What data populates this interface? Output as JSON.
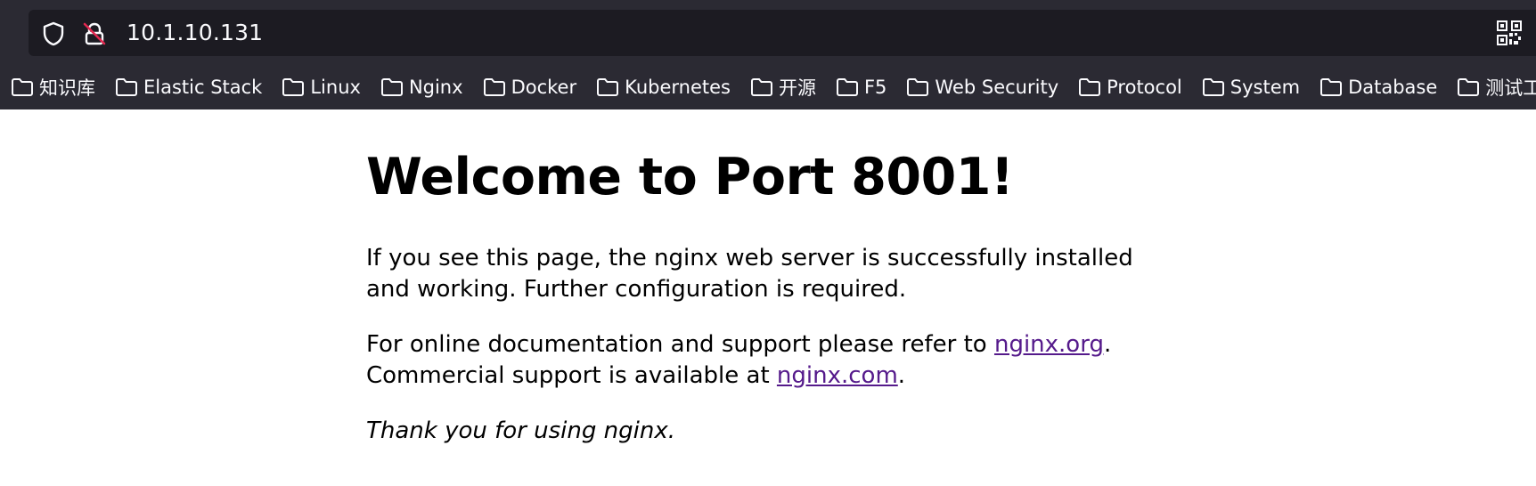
{
  "browser": {
    "url": "10.1.10.131",
    "icons": {
      "shield": "shield-icon",
      "lock": "insecure-lock-icon",
      "qr": "qr-code-icon"
    },
    "bookmarks": [
      {
        "label": "知识库"
      },
      {
        "label": "Elastic Stack"
      },
      {
        "label": "Linux"
      },
      {
        "label": "Nginx"
      },
      {
        "label": "Docker"
      },
      {
        "label": "Kubernetes"
      },
      {
        "label": "开源"
      },
      {
        "label": "F5"
      },
      {
        "label": "Web Security"
      },
      {
        "label": "Protocol"
      },
      {
        "label": "System"
      },
      {
        "label": "Database"
      },
      {
        "label": "测试工"
      }
    ],
    "colors": {
      "chrome_bg": "#2b2a33",
      "urlbar_bg": "#1c1b22",
      "text": "#fbfbfe",
      "insecure_red": "#e22850"
    }
  },
  "page": {
    "title": "Welcome to Port 8001!",
    "p1": "If you see this page, the nginx web server is successfully installed and working. Further configuration is required.",
    "p2_before": "For online documentation and support please refer to ",
    "link_org": "nginx.org",
    "p2_mid": ".",
    "p2_line2": "Commercial support is available at ",
    "link_com": "nginx.com",
    "p2_end": ".",
    "p3": "Thank you for using nginx.",
    "link_color": "#551a8b"
  }
}
